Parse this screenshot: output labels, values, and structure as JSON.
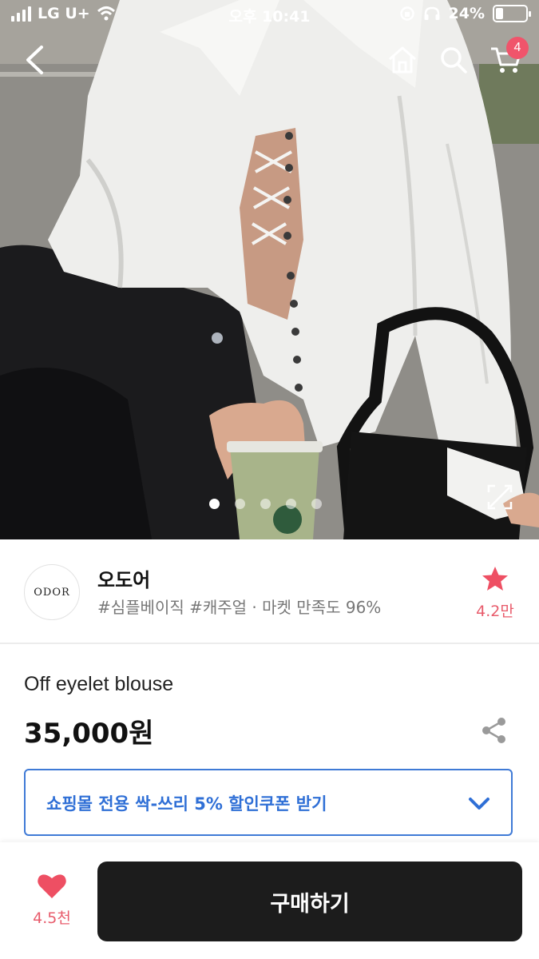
{
  "status_bar": {
    "carrier": "LG U+",
    "time": "오후 10:41",
    "battery": "24%",
    "battery_level": 0.24
  },
  "nav": {
    "cart_badge": "4",
    "icons": [
      "back-icon",
      "home-icon",
      "search-icon",
      "cart-icon"
    ]
  },
  "gallery": {
    "image_count": 5,
    "active_index": 0
  },
  "store": {
    "logo_text": "ODOR",
    "name": "오도어",
    "tags": "#심플베이직 #캐주얼 · 마켓 만족도 96%",
    "favorite_count": "4.2만"
  },
  "product": {
    "name": "Off eyelet blouse",
    "price": "35,000원"
  },
  "coupon": {
    "label": "쇼핑몰 전용 싹-쓰리 5% 할인쿠폰 받기"
  },
  "bottom_bar": {
    "like_count": "4.5천",
    "buy_label": "구매하기"
  },
  "colors": {
    "accent_pink": "#f0546b",
    "coupon_blue": "#2f6fd6",
    "buy_button": "#1c1c1c"
  }
}
